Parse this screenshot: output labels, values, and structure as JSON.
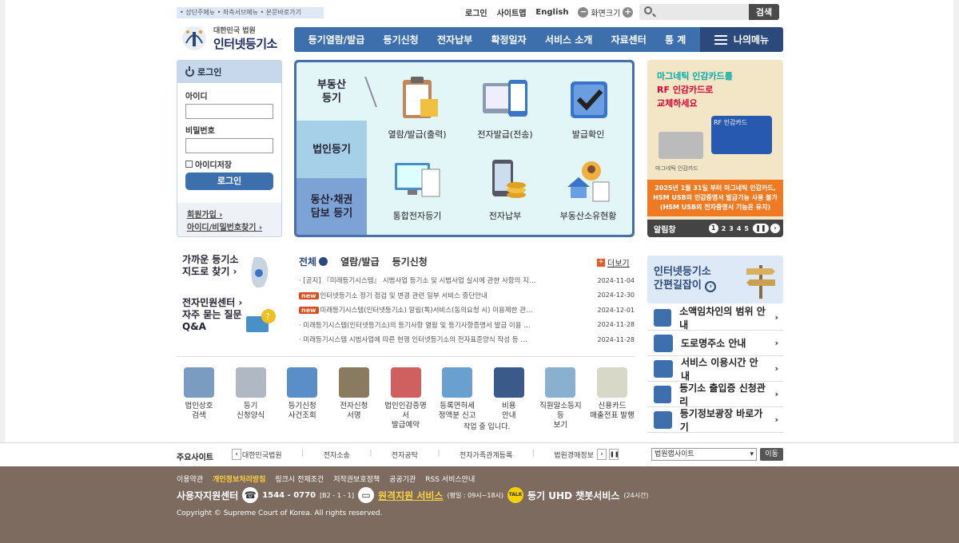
{
  "skip_links": "• 상단주메뉴 • 좌측서브메뉴 • 본문바로가기",
  "util": {
    "login": "로그인",
    "sitemap": "사이트맵",
    "english": "English",
    "zoom": "화면크기",
    "minus": "−",
    "plus": "+"
  },
  "search": {
    "button": "검색"
  },
  "logo": {
    "line1": "대한민국 법원",
    "line2": "인터넷등기소"
  },
  "gnb": [
    "등기열람/발급",
    "등기신청",
    "전자납부",
    "확정일자",
    "서비스 소개",
    "자료센터",
    "통 계"
  ],
  "mymenu": "나의메뉴",
  "login": {
    "title": "로그인",
    "id_label": "아이디",
    "pw_label": "비밀번호",
    "save_id": "아이디저장",
    "button": "로그인",
    "join": "회원가입 ›",
    "find": "아이디/비밀번호찾기 ›"
  },
  "service_tabs": [
    "부동산\n등기",
    "법인등기",
    "동산·채권\n담보 등기"
  ],
  "service_items": [
    "열람/발급(출력)",
    "전자발급(전송)",
    "발급확인",
    "통합전자등기",
    "전자납부",
    "부동산소유현황"
  ],
  "banner": {
    "line1": "마그네틱 인감카드를",
    "line2": "RF 인감카드로",
    "line3": "교체하세요",
    "card_label": "RF 인감카드",
    "old_card": "마그네틱 인감카드",
    "notice": "2025년 1월 31일 부터 마그네틱 인감카드, HSM USB의 인감증명서 발급기능 사용 불가 (HSM USB의 전자증명서 기능은 유지)",
    "alarm": "알림창",
    "pages": [
      "1",
      "2",
      "3",
      "4",
      "5"
    ]
  },
  "find": {
    "map": "가까운 등기소",
    "map2": "지도로 찾기 ›",
    "center": "전자민원센터 ›",
    "faq": "자주 묻는 질문",
    "qa": "Q&A"
  },
  "notice_tabs": [
    "전체",
    "열람/발급",
    "등기신청"
  ],
  "more": "더보기",
  "notices": [
    {
      "title": "[공지] 『미래등기시스템』 시범사업 등기소 및 시범사업 실시에 관한 사항의 지…",
      "date": "2024-11-04",
      "new": ""
    },
    {
      "title": "인터넷등기소 정기 점검 및 변경 관련 일부 서비스 중단안내",
      "date": "2024-12-30",
      "new": "new"
    },
    {
      "title": "미래등기시스템(인터넷등기소) 알림(톡)서비스(동의요청 시) 이용제한 관…",
      "date": "2024-12-01",
      "new": "new"
    },
    {
      "title": "미래등기시스템(인터넷등기소)의 등기사항 열람 및 등기사항증명서 발급 이용 …",
      "date": "2024-11-28",
      "new": ""
    },
    {
      "title": "미래등기시스템 시범사업에 따른 현행 인터넷등기소의 전자표준양식 작성 등 …",
      "date": "2024-11-28",
      "new": ""
    }
  ],
  "quick": [
    "법인상호\n검색",
    "등기\n신청양식",
    "등기신청\n사건조회",
    "전자신청\n서명",
    "법인인감증명서\n발급예약",
    "등록면허세\n정액분 신고",
    "비용\n안내",
    "직원말소등지등\n보기",
    "신용카드\n매출전표 발행"
  ],
  "loading": "작업 중 입니다.",
  "shortcut": {
    "line1": "인터넷등기소",
    "line2": "간편길잡이"
  },
  "rlist": [
    "소액임차인의 범위 안내",
    "도로명주소 안내",
    "서비스 이용시간 안내",
    "등기소 출입증 신청관리",
    "등기정보광장 바로가기"
  ],
  "family": {
    "title": "주요사이트",
    "sites": [
      "대한민국법원",
      "전자소송",
      "전자공탁",
      "전자가족관계등록",
      "법원경매정보"
    ],
    "select": "법원랩사이트",
    "go": "이동"
  },
  "footer": {
    "links": [
      "이용약관",
      "개인정보처리방침",
      "링크시 전제조건",
      "저작권보호정책",
      "공공기관",
      "RSS 서비스안내"
    ],
    "cs": "사용자지원센터",
    "phone": "1544 - 0770",
    "phone_sub": "[B2 - 1 - 1]",
    "remote": "원격지원 서비스",
    "remote_sub": "(평일 : 09시~18시)",
    "chatbot": "등기 UHD 챗봇서비스",
    "chatbot_sub": "(24시간)",
    "copyright": "Copyright © Supreme Court of Korea. All rights reserved."
  },
  "colors": {
    "nav": "#3d6fad",
    "nav_dark": "#2b4a7b",
    "footer": "#7d6b5f",
    "accent_orange": "#f07a22"
  }
}
